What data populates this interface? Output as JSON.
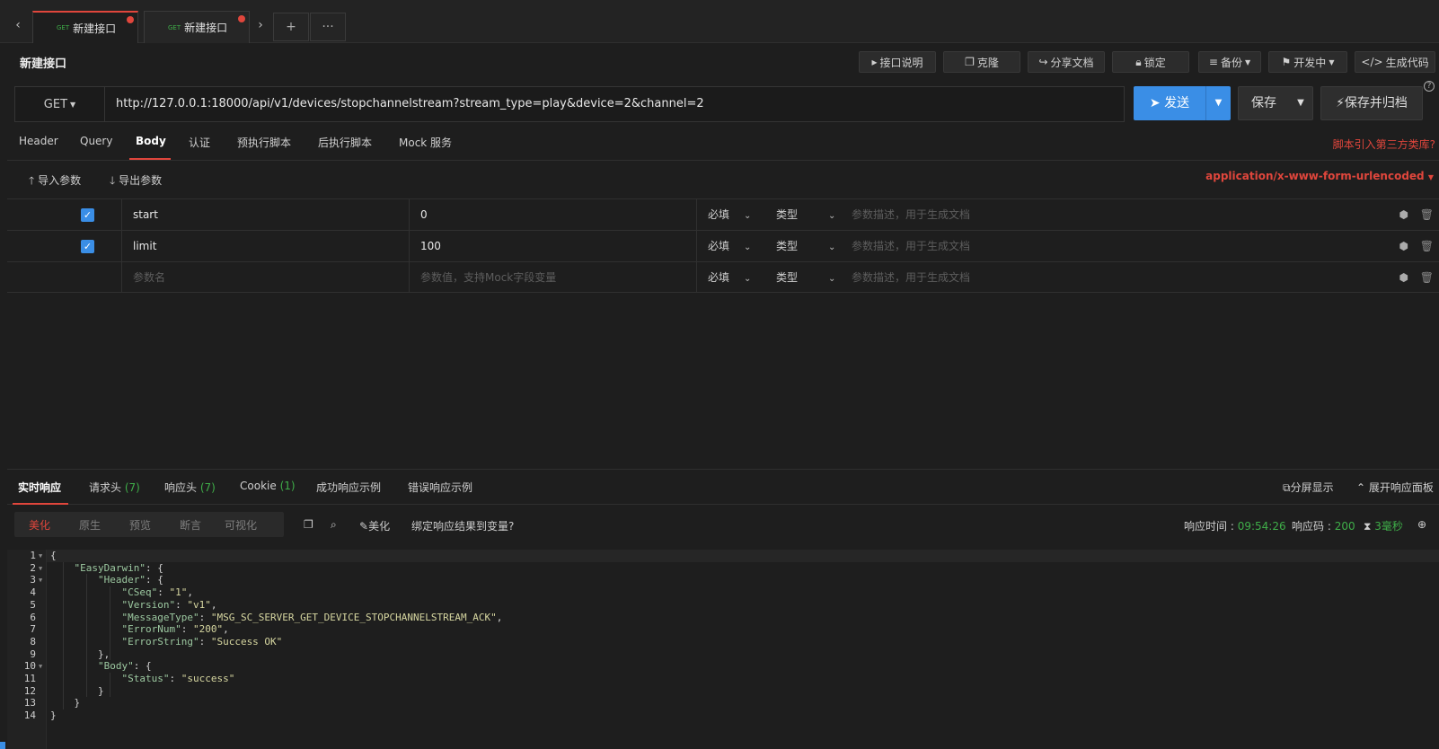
{
  "tabs": [
    {
      "method": "GET",
      "name": "新建接口",
      "active": true,
      "unsaved": true
    },
    {
      "method": "GET",
      "name": "新建接口",
      "active": false,
      "unsaved": true
    }
  ],
  "tabbar": {
    "prev": "‹",
    "next": "›",
    "add": "+",
    "more": "···"
  },
  "title": "新建接口",
  "toolbar": {
    "doc": "接口说明",
    "clone": "克隆",
    "share": "分享文档",
    "lock": "锁定",
    "backup": "备份",
    "status": "开发中",
    "gencode": "生成代码"
  },
  "request": {
    "method": "GET",
    "url": "http://127.0.0.1:18000/api/v1/devices/stopchannelstream?stream_type=play&device=2&channel=2",
    "send": "发送",
    "save": "保存",
    "save_archive": "保存并归档",
    "help": "?"
  },
  "request_tabs": [
    "Header",
    "Query",
    "Body",
    "认证",
    "预执行脚本",
    "后执行脚本",
    "Mock 服务"
  ],
  "active_request_tab": "Body",
  "third_party": "脚本引入第三方类库?",
  "body": {
    "import": "导入参数",
    "export": "导出参数",
    "content_type": "application/x-www-form-urlencoded",
    "params": [
      {
        "checked": true,
        "name": "start",
        "value": "0",
        "required": "必填",
        "type": "类型",
        "desc_placeholder": "参数描述，用于生成文档"
      },
      {
        "checked": true,
        "name": "limit",
        "value": "100",
        "required": "必填",
        "type": "类型",
        "desc_placeholder": "参数描述，用于生成文档"
      }
    ],
    "new_row": {
      "name_placeholder": "参数名",
      "value_placeholder": "参数值，支持Mock字段变量",
      "required": "必填",
      "type": "类型",
      "desc_placeholder": "参数描述，用于生成文档"
    }
  },
  "response": {
    "tabs": [
      {
        "label": "实时响应",
        "count": ""
      },
      {
        "label": "请求头",
        "count": "(7)"
      },
      {
        "label": "响应头",
        "count": "(7)"
      },
      {
        "label": "Cookie",
        "count": "(1)"
      },
      {
        "label": "成功响应示例",
        "count": ""
      },
      {
        "label": "错误响应示例",
        "count": ""
      }
    ],
    "split_view": "分屏显示",
    "expand_panel": "展开响应面板",
    "views": [
      "美化",
      "原生",
      "预览",
      "断言",
      "可视化"
    ],
    "active_view": "美化",
    "beautify": "美化",
    "bind_var": "绑定响应结果到变量?",
    "time_label": "响应时间 : ",
    "time": "09:54:26",
    "code_label": "响应码 : ",
    "code": "200",
    "duration": "3毫秒",
    "lines": [
      "{",
      "    \"EasyDarwin\": {",
      "        \"Header\": {",
      "            \"CSeq\": \"1\",",
      "            \"Version\": \"v1\",",
      "            \"MessageType\": \"MSG_SC_SERVER_GET_DEVICE_STOPCHANNELSTREAM_ACK\",",
      "            \"ErrorNum\": \"200\",",
      "            \"ErrorString\": \"Success OK\"",
      "        },",
      "        \"Body\": {",
      "            \"Status\": \"success\"",
      "        }",
      "    }",
      "}"
    ]
  },
  "colors": {
    "accent": "#e0463c",
    "primary": "#3a8ee6",
    "success": "#3fae49",
    "background": "#1e1e1e"
  }
}
